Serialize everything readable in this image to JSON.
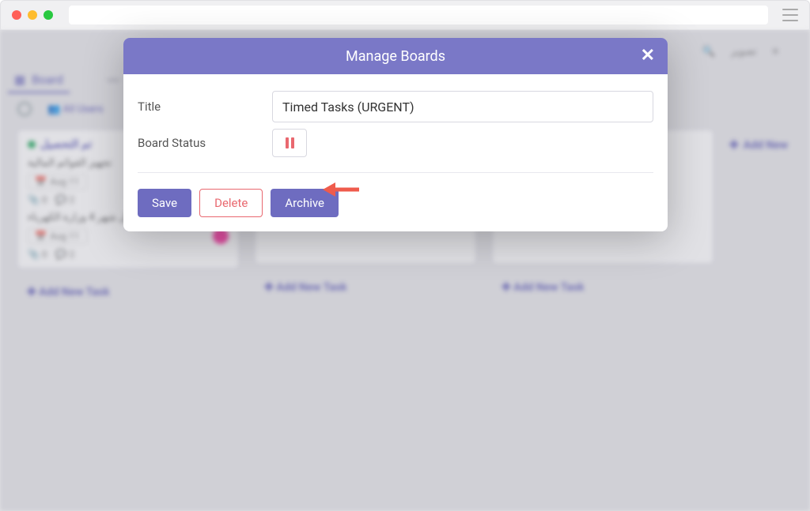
{
  "browser": {
    "url": ""
  },
  "topbar": {
    "search_placeholder": "تصوير"
  },
  "tabs": {
    "board": "Board",
    "list_icon": "list"
  },
  "filter": {
    "all_users": "All Users"
  },
  "boards": [
    {
      "title": "تم التحصيل",
      "tasks": [
        {
          "name": "تجهيز القوائم المالية",
          "date": "Aug 11",
          "comments": 2,
          "attachments": 0
        },
        {
          "name": "تحصيل شهر 4 وزارة الكهرباء",
          "date": "Aug 11",
          "comments": 2,
          "attachments": 0
        }
      ],
      "add_label": "Add New Task"
    },
    {
      "title": "",
      "tasks": [],
      "add_label": "Add New Task"
    },
    {
      "title": "",
      "tasks": [],
      "add_label": "Add New Task"
    }
  ],
  "add_board": "Add New",
  "modal": {
    "header": "Manage Boards",
    "labels": {
      "title": "Title",
      "status": "Board Status"
    },
    "values": {
      "title": "Timed Tasks (URGENT)"
    },
    "buttons": {
      "save": "Save",
      "delete": "Delete",
      "archive": "Archive"
    }
  },
  "colors": {
    "accent": "#6e6cc0",
    "danger": "#e9686f"
  }
}
